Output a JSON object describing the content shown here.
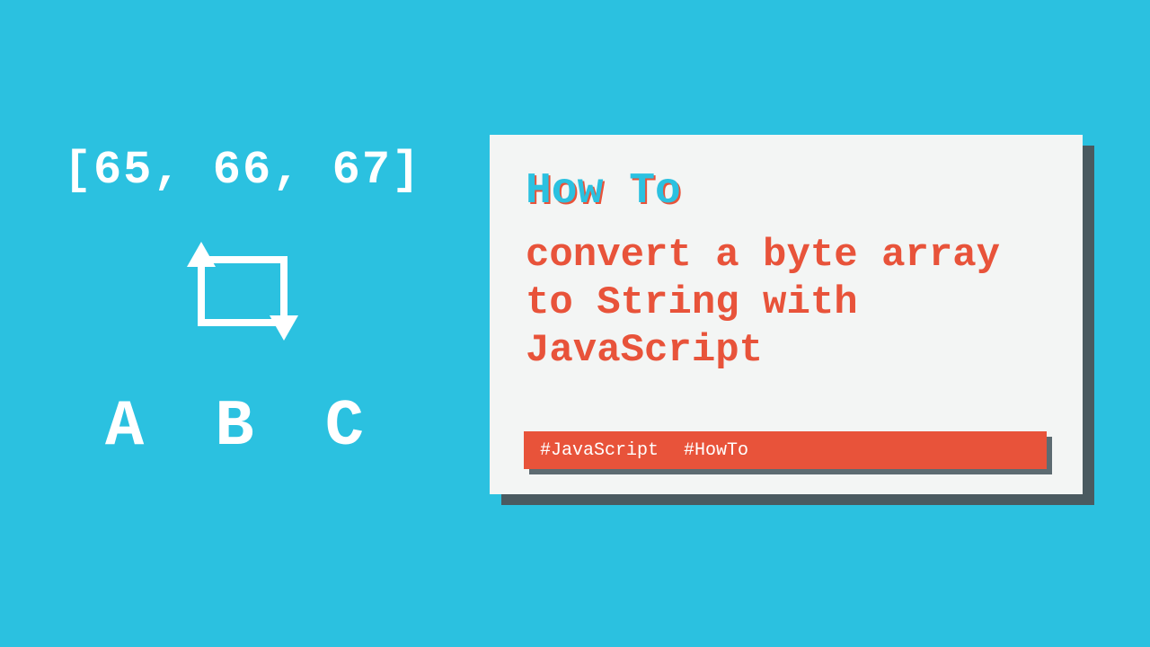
{
  "left": {
    "byte_array": "[65, 66, 67]",
    "result": "A B C"
  },
  "card": {
    "howto": "How To",
    "title": "convert a byte array to String with JavaScript",
    "tags": [
      "#JavaScript",
      "#HowTo"
    ]
  },
  "colors": {
    "bg": "#2bc1e0",
    "accent": "#e8533a",
    "cardBg": "#f3f5f4",
    "shadow": "#4a5a60"
  }
}
